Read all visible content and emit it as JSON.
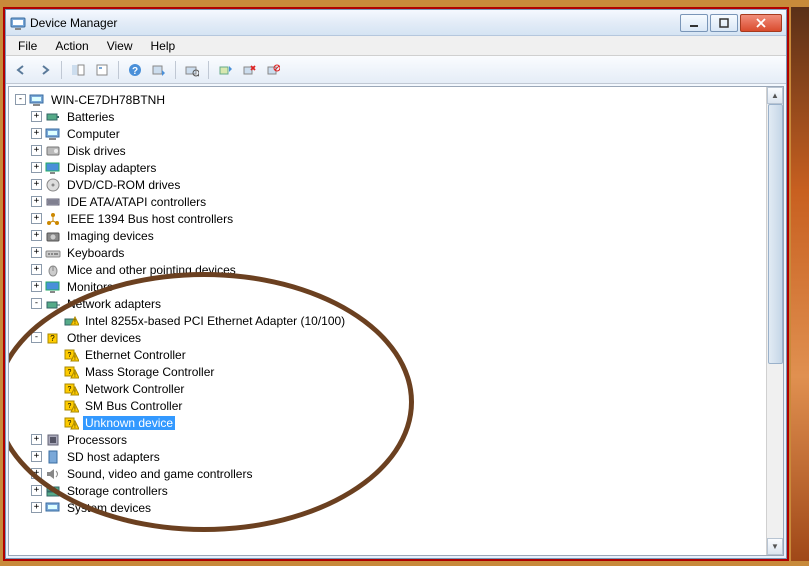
{
  "window": {
    "title": "Device Manager"
  },
  "menu": {
    "file": "File",
    "action": "Action",
    "view": "View",
    "help": "Help"
  },
  "tree": {
    "root": "WIN-CE7DH78BTNH",
    "batteries": "Batteries",
    "computer": "Computer",
    "disk_drives": "Disk drives",
    "display_adapters": "Display adapters",
    "dvd": "DVD/CD-ROM drives",
    "ide": "IDE ATA/ATAPI controllers",
    "ieee1394": "IEEE 1394 Bus host controllers",
    "imaging": "Imaging devices",
    "keyboards": "Keyboards",
    "mice": "Mice and other pointing devices",
    "monitors": "Monitors",
    "network_adapters": "Network adapters",
    "intel_nic": "Intel 8255x-based PCI Ethernet Adapter (10/100)",
    "other_devices": "Other devices",
    "ethernet_ctrl": "Ethernet Controller",
    "mass_storage_ctrl": "Mass Storage Controller",
    "network_ctrl": "Network Controller",
    "sm_bus_ctrl": "SM Bus Controller",
    "unknown_device": "Unknown device",
    "processors": "Processors",
    "sd_host": "SD host adapters",
    "sound": "Sound, video and game controllers",
    "storage_ctrl": "Storage controllers",
    "system_devices": "System devices"
  }
}
